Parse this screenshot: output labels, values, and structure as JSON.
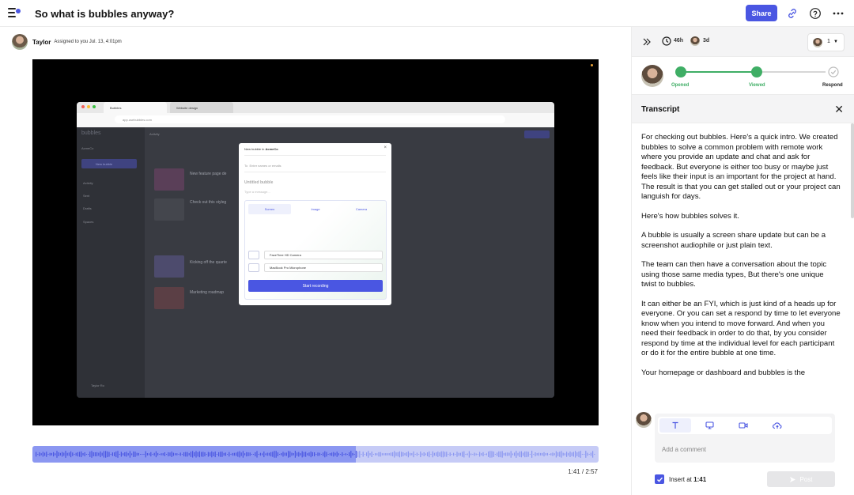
{
  "header": {
    "title": "So what is bubbles anyway?",
    "share_label": "Share"
  },
  "author": {
    "name": "Taylor",
    "meta": "Assigned to you Jul. 13, 4:01pm"
  },
  "video": {
    "browser": {
      "tab_active": "Bubbles",
      "tab_inactive": "Website design",
      "url": "app.usebubbles.com"
    },
    "app": {
      "logo": "bubbles",
      "workspace": "AcmeCo",
      "new_bubble_label": "New bubble",
      "nav": [
        "Activity",
        "Sent",
        "Drafts",
        "Spaces"
      ],
      "heading": "Activity",
      "items": [
        "New feature page de",
        "Check out this styleg",
        "Kicking off the quarte",
        "Marketing roadmap"
      ],
      "user": "Taylor Ro"
    },
    "modal": {
      "title_prefix": "New bubble in",
      "workspace": "AcmeCo",
      "to_label": "To",
      "to_placeholder": "Enter names or emails",
      "untitled": "Untitled bubble",
      "message_placeholder": "Type a message...",
      "tabs": [
        "Screen",
        "Image",
        "Camera"
      ],
      "camera": "FaceTime HD Camera",
      "microphone": "MacBook Pro Microphone",
      "start_label": "Start recording"
    }
  },
  "playback": {
    "current": "1:41",
    "total": "2:57",
    "timecode": "1:41 / 2:57",
    "played_fraction": 0.571
  },
  "sidebar": {
    "time_left": "46h",
    "respond_by": "3d",
    "assignee_count": "1",
    "steps": [
      {
        "label": "Opened",
        "done": true
      },
      {
        "label": "Viewed",
        "done": true
      },
      {
        "label": "Respond",
        "done": false
      }
    ],
    "transcript_title": "Transcript",
    "transcript": [
      "For checking out bubbles. Here's a quick intro. We created bubbles to solve a common problem with remote work where you provide an update and chat and ask for feedback. But everyone is either too busy or maybe just feels like their input is an important for the project at hand. The result is that you can get stalled out or your project can languish for days.",
      "Here's how bubbles solves it.",
      "A bubble is usually a screen share update but can be a screenshot audiophile or just plain text.",
      "The team can then have a conversation about the topic using those same media types, But there's one unique twist to bubbles.",
      "It can either be an FYI, which is just kind of a heads up for everyone. Or you can set a respond by time to let everyone know when you intend to move forward. And when you need their feedback in order to do that, by you consider respond by time at the individual level for each participant or do it for the entire bubble at one time.",
      "Your homepage or dashboard and bubbles is the"
    ],
    "comment_placeholder": "Add a comment",
    "insert_at_prefix": "Insert at",
    "insert_at_time": "1:41",
    "post_label": "Post"
  },
  "colors": {
    "accent": "#4a56e2",
    "success": "#3fae65",
    "wave_played": "#8b97f1",
    "wave_unplayed": "#c6cbf6"
  }
}
